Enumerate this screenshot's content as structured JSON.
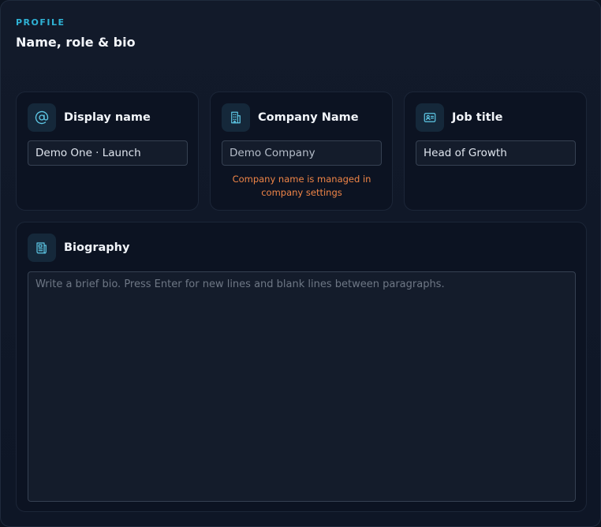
{
  "header": {
    "eyebrow": "PROFILE",
    "title": "Name, role & bio"
  },
  "cards": {
    "display_name": {
      "label": "Display name",
      "icon": "at-sign-icon",
      "value": "Demo One · Launch"
    },
    "company_name": {
      "label": "Company Name",
      "icon": "building-icon",
      "value": "Demo Company",
      "note": "Company name is managed in company settings"
    },
    "job_title": {
      "label": "Job title",
      "icon": "id-card-icon",
      "value": "Head of Growth"
    },
    "biography": {
      "label": "Biography",
      "icon": "newspaper-icon",
      "value": "",
      "placeholder": "Write a brief bio. Press Enter for new lines and blank lines between paragraphs."
    }
  },
  "colors": {
    "accent": "#2fb3d6",
    "warning": "#f08547",
    "icon_stroke": "#5ec8e6"
  }
}
